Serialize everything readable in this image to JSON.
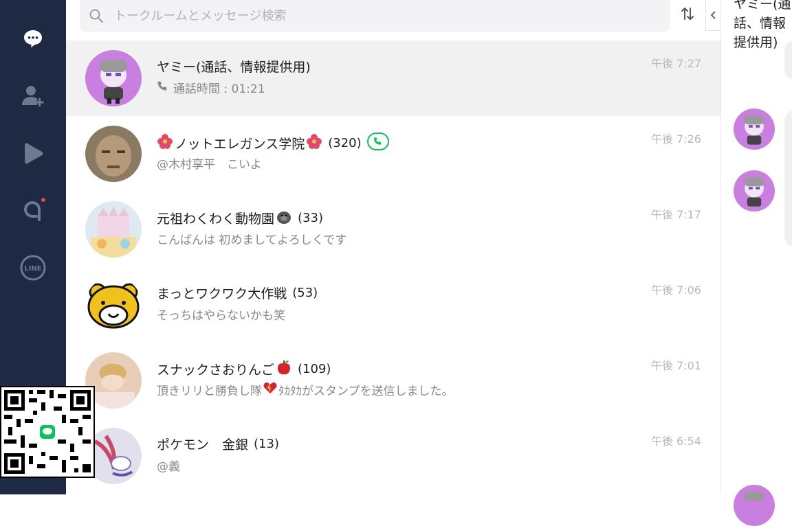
{
  "search": {
    "placeholder": "トークルームとメッセージ検索"
  },
  "chat_header": {
    "title": "ヤミー(通話、情報提供用)"
  },
  "chats": [
    {
      "name": "ヤミー(通話、情報提供用)",
      "count": "",
      "preview": "通話時間 : 01:21",
      "time": "午後 7:27"
    },
    {
      "name": "ノットエレガンス学院",
      "count": "(320)",
      "preview": "@木村享平　こいよ",
      "time": "午後 7:26"
    },
    {
      "name": "元祖わくわく動物園",
      "count": "(33)",
      "preview": "こんばんは 初めましてよろしくです",
      "time": "午後 7:17"
    },
    {
      "name": "まっとワクワク大作戦",
      "count": "(53)",
      "preview": "そっちはやらないかも笑",
      "time": "午後 7:06"
    },
    {
      "name": "スナックさおりんご",
      "count": "(109)",
      "preview_a": "頂きリリと勝負し隊",
      "preview_b": "ﾀｶﾀｶがスタンプを送信しました。",
      "time": "午後 7:01"
    },
    {
      "name": "ポケモン　金銀",
      "count": "(13)",
      "preview": "@義",
      "time": "午後 6:54"
    }
  ],
  "colors": {
    "sidebar": "#1e2a44",
    "accent_green": "#06c755",
    "selected_row": "#f1f1f1"
  }
}
